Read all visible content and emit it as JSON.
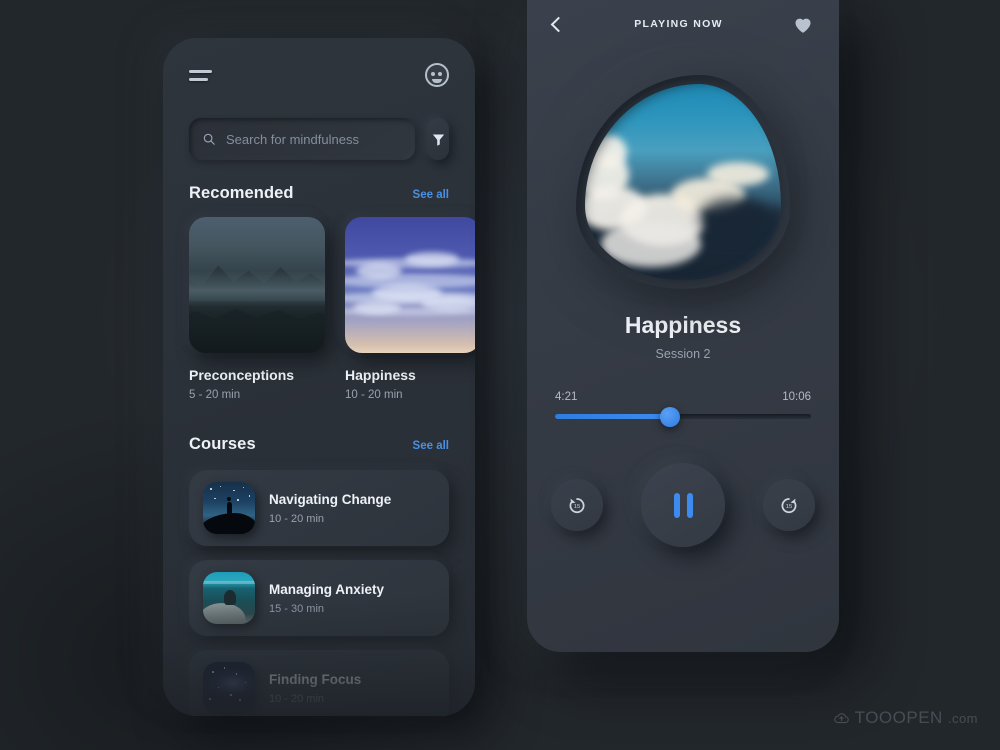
{
  "theme": {
    "page_background": "#22272b",
    "accent_blue": "#3d8bef",
    "link_blue": "#4a90e2",
    "text_primary": "#eef2f7",
    "text_secondary": "#98a1af"
  },
  "home_screen": {
    "menu_icon": "hamburger-menu-icon",
    "avatar_icon": "user-avatar-icon",
    "search": {
      "icon": "search-icon",
      "value": "",
      "placeholder": "Search for mindfulness"
    },
    "filter_icon": "filter-funnel-icon",
    "recommended": {
      "title": "Recomended",
      "see_all": "See all",
      "cards": [
        {
          "title": "Preconceptions",
          "duration": "5 - 20 min",
          "art": "mountains-at-dusk"
        },
        {
          "title": "Happiness",
          "duration": "10 - 20 min",
          "art": "blue-cloud-sky"
        }
      ]
    },
    "courses": {
      "title": "Courses",
      "see_all": "See all",
      "items": [
        {
          "title": "Navigating Change",
          "duration": "10 - 20 min",
          "art": "starry-night-silhouette"
        },
        {
          "title": "Managing Anxiety",
          "duration": "15 - 30 min",
          "art": "teal-water-meditation"
        },
        {
          "title": "Finding Focus",
          "duration": "10 - 20 min",
          "art": "galaxy-night-sky"
        }
      ]
    }
  },
  "player_screen": {
    "back_icon": "back-chevron-icon",
    "header_title": "PLAYING NOW",
    "favorite_icon": "heart-icon",
    "artwork": "sunlit-clouds-blob",
    "track_title": "Happiness",
    "track_subtitle": "Session 2",
    "progress": {
      "current_time": "4:21",
      "total_time": "10:06",
      "percent": 45
    },
    "controls": {
      "rewind_icon": "rewind-15-icon",
      "rewind_label": "15",
      "play_pause_icon": "pause-icon",
      "forward_icon": "forward-15-icon",
      "forward_label": "15"
    }
  },
  "watermark": {
    "icon": "cloud-upload-icon",
    "name": "TOOOPEN",
    "suffix": ".com"
  }
}
